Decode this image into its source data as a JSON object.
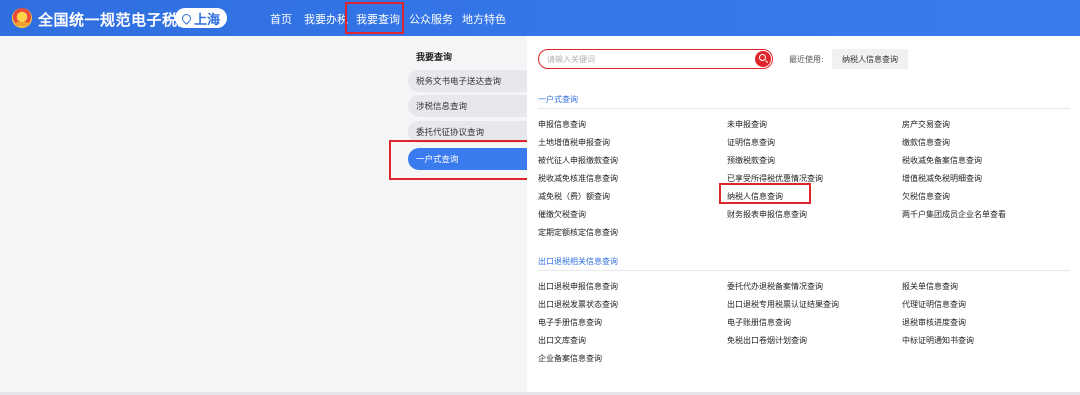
{
  "header": {
    "site_title": "全国统一规范电子税务局",
    "region": "上海",
    "nav": [
      "首页",
      "我要办税",
      "我要查询",
      "公众服务",
      "地方特色"
    ],
    "active_nav": "我要查询"
  },
  "sidebar": {
    "title": "我要查询",
    "items": [
      "税务文书电子送达查询",
      "涉税信息查询",
      "委托代征协议查询",
      "一户式查询"
    ],
    "active_item": "一户式查询"
  },
  "search": {
    "placeholder": "请输入关键词",
    "recent_label": "最近使用:",
    "recent_item": "纳税人信息查询"
  },
  "sections": [
    {
      "title": "一户式查询",
      "items": [
        "申报信息查询",
        "未申报查询",
        "房产交易查询",
        "土地增值税申报查询",
        "证明信息查询",
        "缴款信息查询",
        "被代征人申报缴款查询",
        "预缴税款查询",
        "税收减免备案信息查询",
        "税收减免核准信息查询",
        "已享受所得税优惠情况查询",
        "增值税减免税明细查询",
        "减免税（费）额查询",
        "纳税人信息查询",
        "欠税信息查询",
        "催缴欠税查询",
        "财务报表申报信息查询",
        "两千户集团成员企业名单查看",
        "定期定额核定信息查询"
      ]
    },
    {
      "title": "出口退税相关信息查询",
      "items": [
        "出口退税申报信息查询",
        "委托代办退税备案情况查询",
        "报关单信息查询",
        "出口退税发票状态查询",
        "出口退税专用税票认证结果查询",
        "代理证明信息查询",
        "电子手册信息查询",
        "电子账册信息查询",
        "退税审核进度查询",
        "出口文库查询",
        "免税出口卷烟计划查询",
        "中标证明通知书查询",
        "企业备案信息查询"
      ]
    }
  ],
  "colors": {
    "brand": "#3a7cf0",
    "highlight": "#e0242c",
    "link": "#2f6fe0"
  }
}
